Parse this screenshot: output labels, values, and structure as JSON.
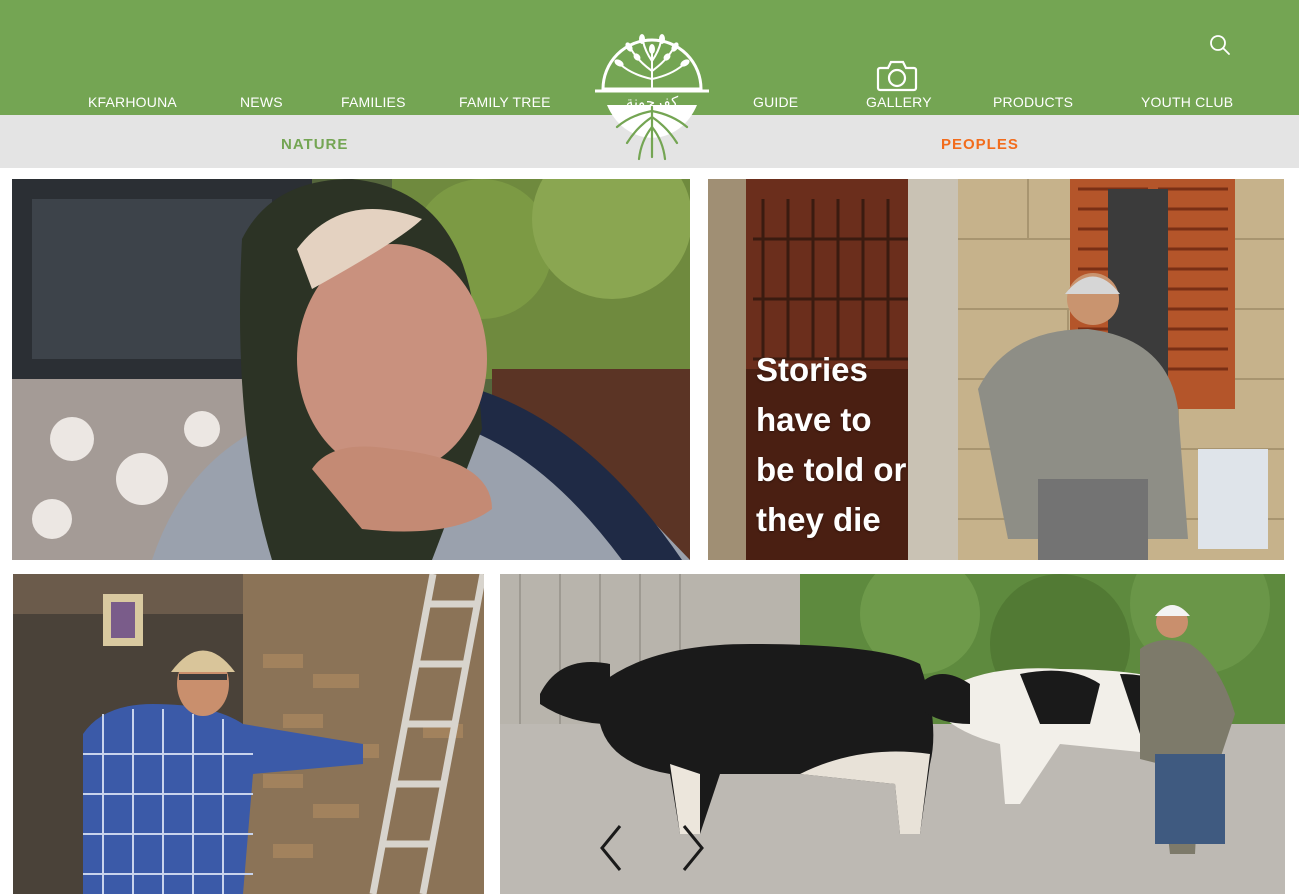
{
  "header": {
    "nav_left": [
      "KFARHOUNA",
      "NEWS",
      "FAMILIES",
      "FAMILY TREE"
    ],
    "nav_right": [
      "GUIDE",
      "GALLERY",
      "PRODUCTS",
      "YOUTH CLUB"
    ],
    "logo_text": "كفرحونة"
  },
  "subnav": {
    "left": "NATURE",
    "right": "PEOPLES"
  },
  "hero": {
    "quote_lines": [
      "Stories",
      "have to",
      "be told or",
      "they die"
    ]
  },
  "colors": {
    "brand_green": "#74a553",
    "subnav_bg": "#e4e4e4",
    "nature": "#74a553",
    "peoples": "#f26c1c"
  },
  "icons": {
    "search": "search-icon",
    "gallery": "camera-icon",
    "prev": "chevron-left-icon",
    "next": "chevron-right-icon"
  }
}
